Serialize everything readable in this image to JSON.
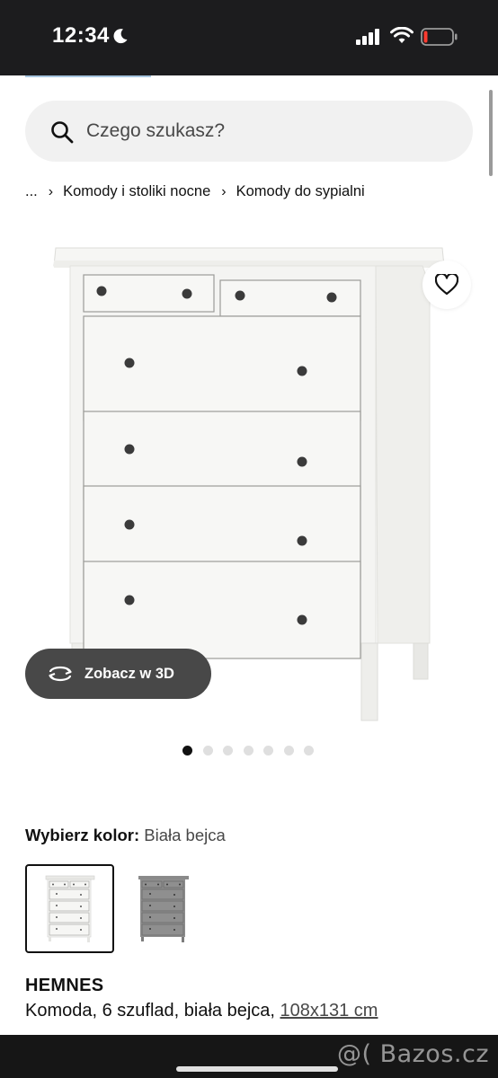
{
  "status_bar": {
    "time": "12:34",
    "icons": [
      "moon-icon",
      "signal-icon",
      "wifi-icon",
      "battery-icon"
    ]
  },
  "search": {
    "placeholder": "Czego szukasz?",
    "icon": "search-icon"
  },
  "breadcrumb": {
    "items": [
      "...",
      "Komody i stoliki nocne",
      "Komody do sypialni"
    ],
    "separator": "›"
  },
  "product_image": {
    "wishlist_icon": "heart-icon",
    "view3d_label": "Zobacz w 3D",
    "view3d_icon": "rotate-3d-icon",
    "carousel": {
      "total": 7,
      "active": 1
    }
  },
  "color": {
    "label": "Wybierz kolor:",
    "value": "Biała bejca",
    "options": [
      {
        "name": "white-stain",
        "color": "#f4f4f2",
        "selected": true
      },
      {
        "name": "grey-stain",
        "color": "#8e8e8e",
        "selected": false
      }
    ]
  },
  "product": {
    "name": "HEMNES",
    "description": "Komoda, 6 szuflad, biała bejca,",
    "size": "108x131 cm"
  },
  "watermark": "@( Bazos.cz",
  "colors": {
    "status_bar_bg": "#1c1c1e",
    "search_bg": "#f1f1f1",
    "button_dark": "#484848",
    "accent": "#0058a3"
  }
}
